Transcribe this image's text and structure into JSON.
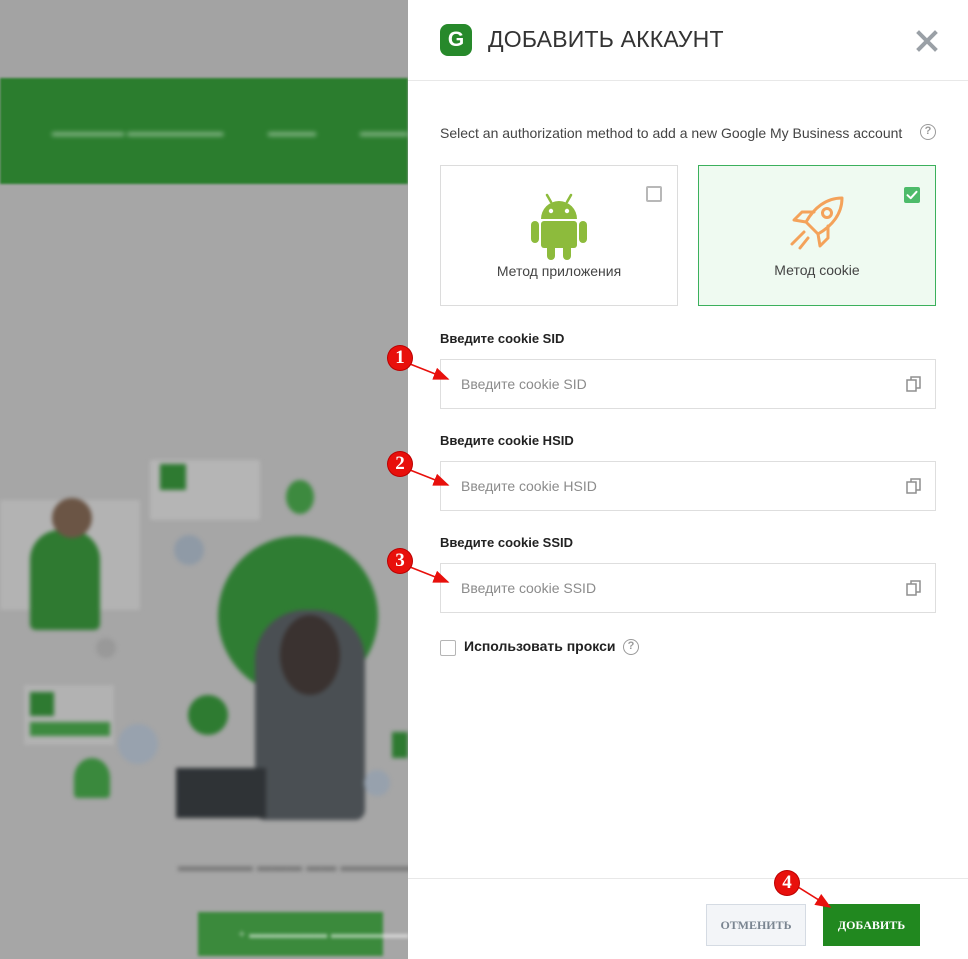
{
  "dialog": {
    "logo_letter": "G",
    "title": "ДОБАВИТЬ АККАУНТ",
    "subtitle": "Select an authorization method to add a new Google My Business account",
    "methods": [
      {
        "label": "Метод приложения",
        "icon": "android-icon",
        "checked": false
      },
      {
        "label": "Метод cookie",
        "icon": "rocket-icon",
        "checked": true
      }
    ],
    "fields": [
      {
        "label": "Введите cookie SID",
        "placeholder": "Введите cookie SID",
        "value": ""
      },
      {
        "label": "Введите cookie HSID",
        "placeholder": "Введите cookie HSID",
        "value": ""
      },
      {
        "label": "Введите cookie SSID",
        "placeholder": "Введите cookie SSID",
        "value": ""
      }
    ],
    "proxy_label": "Использовать прокси",
    "proxy_checked": false,
    "cancel_label": "ОТМЕНИТЬ",
    "add_label": "ДОБАВИТЬ",
    "help_glyph": "?"
  },
  "markers": [
    "1",
    "2",
    "3",
    "4"
  ],
  "colors": {
    "accent": "#21881f",
    "selected_border": "#3bb05c",
    "selected_bg": "#effaf1",
    "android": "#8dbb3c",
    "rocket": "#f4a25a",
    "marker": "#e8100c"
  }
}
